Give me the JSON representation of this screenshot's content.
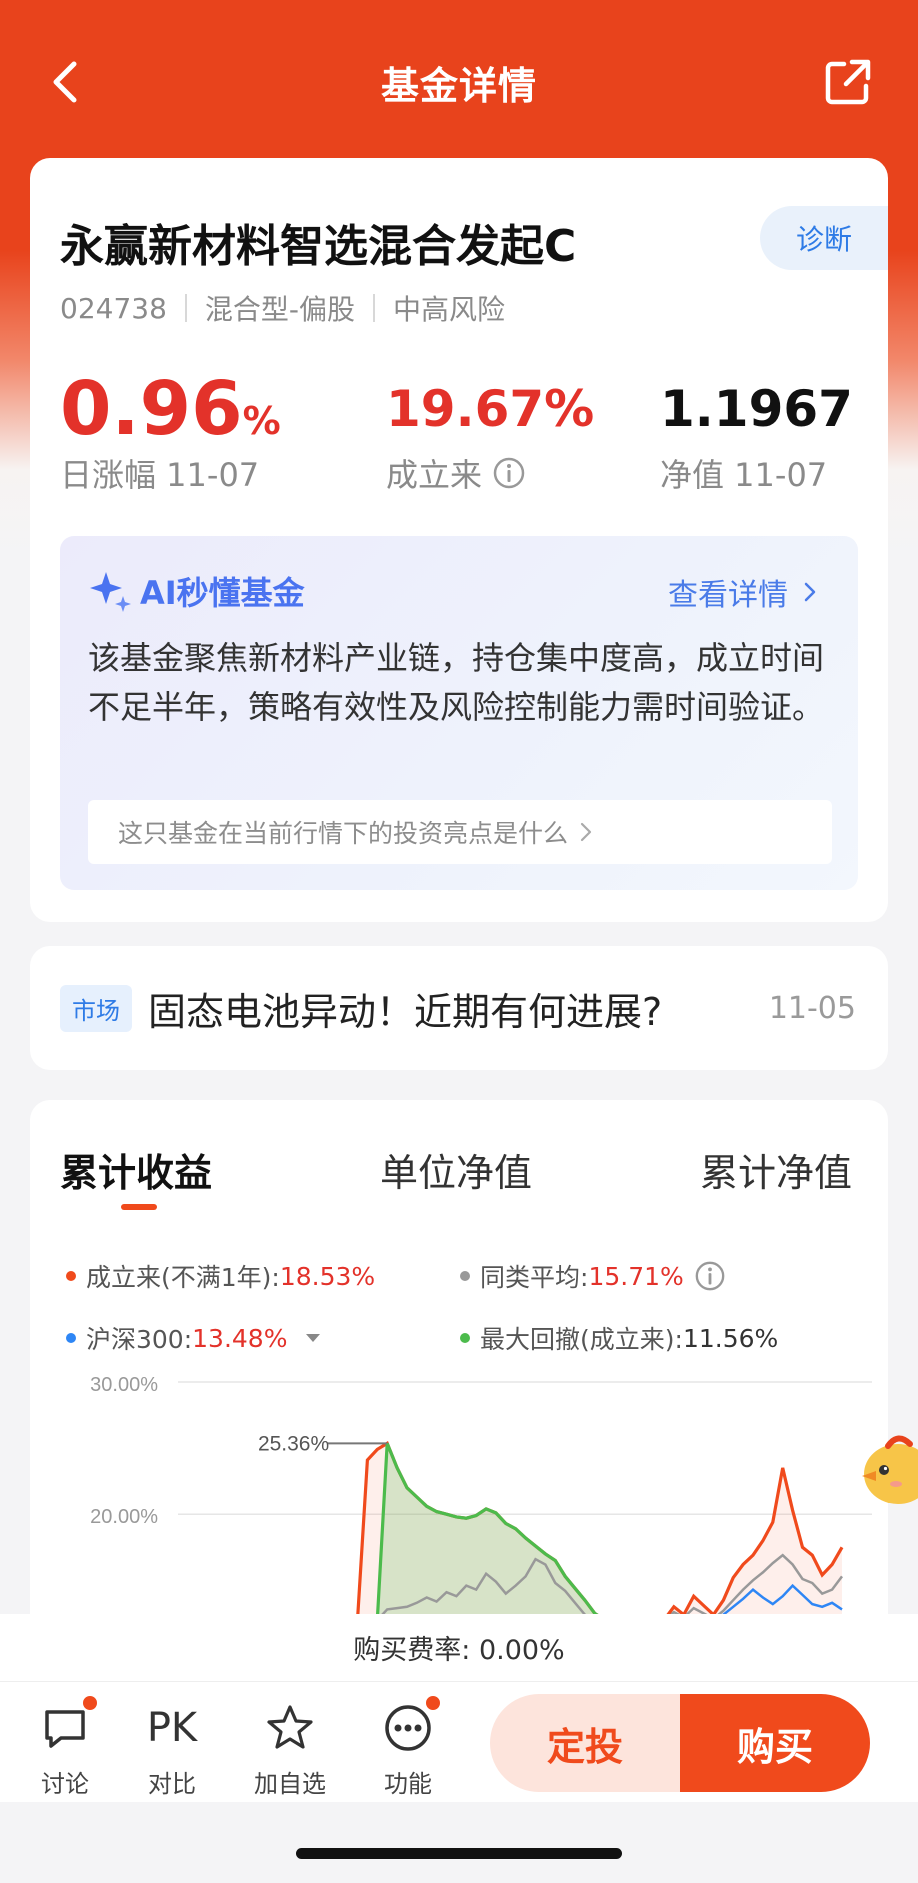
{
  "header": {
    "title": "基金详情"
  },
  "fund": {
    "name": "永赢新材料智选混合发起C",
    "code": "024738",
    "type": "混合型-偏股",
    "risk": "中高风险",
    "diag_label": "诊断",
    "daily_change": "0.96",
    "daily_change_unit": "%",
    "daily_change_label": "日涨幅 11-07",
    "since_inception": "19.67%",
    "since_inception_label": "成立来",
    "nav": "1.1967",
    "nav_label": "净值 11-07"
  },
  "ai": {
    "title": "AI秒懂基金",
    "detail_link": "查看详情",
    "summary": "该基金聚焦新材料产业链，持仓集中度高，成立时间不足半年，策略有效性及风险控制能力需时间验证。",
    "question": "这只基金在当前行情下的投资亮点是什么"
  },
  "news": {
    "tag": "市场",
    "title": "固态电池异动！近期有何进展?",
    "date": "11-05"
  },
  "chart_tabs": [
    {
      "label": "累计收益",
      "active": true
    },
    {
      "label": "单位净值",
      "active": false
    },
    {
      "label": "累计净值",
      "active": false
    }
  ],
  "legend": [
    {
      "name": "成立来(不满1年):",
      "value": "18.53%",
      "color": "#f04a1c"
    },
    {
      "name": "同类平均:",
      "value": "15.71%",
      "color": "#999999"
    },
    {
      "name": "沪深300:",
      "value": "13.48%",
      "color": "#2e86f5"
    },
    {
      "name": "最大回撤(成立来):",
      "value": "11.56%",
      "color": "#4cbb4c"
    }
  ],
  "chart_data": {
    "type": "line",
    "yticks": [
      "30.00%",
      "20.00%"
    ],
    "ylim": [
      12,
      30
    ],
    "peak_label": "25.36%",
    "series": [
      {
        "name": "成立来(不满1年)",
        "color": "#f04a1c",
        "values": [
          12,
          12,
          12,
          12,
          12,
          12,
          12,
          12,
          12,
          12,
          12,
          12,
          12,
          12,
          12,
          12,
          12,
          12,
          12,
          12,
          12,
          12,
          12,
          24.1,
          24.9,
          25.36,
          23.5,
          22.0,
          21.3,
          20.6,
          20.2,
          20.0,
          19.8,
          19.7,
          19.9,
          20.4,
          20.1,
          19.3,
          18.9,
          18.2,
          17.6,
          17.0,
          16.5,
          15.3,
          14.4,
          13.5,
          12.5,
          12,
          12,
          12,
          12,
          12,
          12,
          12,
          13.0,
          12.4,
          13.8,
          13.1,
          12.4,
          13.5,
          15.2,
          16.2,
          16.9,
          18.0,
          19.4,
          23.5,
          20.3,
          17.5,
          16.9,
          15.4,
          16.2,
          17.5
        ]
      },
      {
        "name": "同类平均",
        "color": "#999999",
        "values": [
          12,
          12,
          12,
          12,
          12,
          12,
          12,
          12,
          12,
          12,
          12,
          12,
          12,
          12,
          12,
          12,
          12,
          12,
          12,
          12,
          12,
          12,
          12,
          12,
          12,
          12.8,
          12.9,
          13.0,
          13.3,
          13.7,
          13.4,
          14.1,
          13.8,
          14.6,
          14.3,
          15.5,
          14.9,
          14.0,
          14.6,
          15.3,
          16.6,
          16.2,
          14.8,
          14.2,
          13.3,
          12.4,
          12.0,
          12,
          12,
          12,
          12,
          12,
          12,
          12,
          12.6,
          12.2,
          12.9,
          12.5,
          12.1,
          12.7,
          13.5,
          14.3,
          15.0,
          15.6,
          16.3,
          16.9,
          16.2,
          15.1,
          14.8,
          14.0,
          14.3,
          15.3
        ]
      },
      {
        "name": "沪深300",
        "color": "#2e86f5",
        "values": [
          12,
          12,
          12,
          12,
          12,
          12,
          12,
          12,
          12,
          12,
          12,
          12,
          12,
          12,
          12,
          12,
          12,
          12,
          12,
          12,
          12,
          12,
          12,
          12,
          12,
          12,
          12,
          12,
          12,
          12,
          12,
          12,
          12,
          12,
          12,
          12,
          12,
          12,
          12,
          12,
          12,
          12,
          12,
          12,
          12,
          12,
          12,
          12,
          12,
          12,
          12,
          12,
          12,
          12,
          12,
          12,
          12,
          12,
          12,
          12.4,
          13.0,
          13.6,
          14.3,
          13.7,
          13.2,
          13.8,
          14.6,
          13.9,
          13.2,
          13.0,
          13.3,
          12.8
        ]
      },
      {
        "name": "最大回撤(成立来)",
        "color": "#4cbb4c",
        "values": [
          12,
          12,
          12,
          12,
          12,
          12,
          12,
          12,
          12,
          12,
          12,
          12,
          12,
          12,
          12,
          12,
          12,
          12,
          12,
          12,
          12,
          12,
          12,
          12,
          12,
          25.36,
          23.5,
          22.0,
          21.3,
          20.6,
          20.2,
          20.0,
          19.8,
          19.7,
          19.9,
          20.4,
          20.1,
          19.3,
          18.9,
          18.2,
          17.6,
          17.0,
          16.5,
          15.3,
          14.4,
          13.5,
          12.5,
          12,
          12,
          12,
          12,
          12,
          12,
          12,
          12,
          12,
          12,
          12,
          12,
          12,
          12,
          12,
          12,
          12,
          12,
          12,
          12,
          12,
          12,
          12,
          12,
          12
        ]
      }
    ]
  },
  "fee": {
    "text": "购买费率: 0.00%"
  },
  "bottom": {
    "discuss": "讨论",
    "compare_icon": "PK",
    "compare": "对比",
    "watch": "加自选",
    "more": "功能",
    "dingtou": "定投",
    "buy": "购买"
  },
  "icons": {
    "back": "chevron-left-icon",
    "share": "share-icon",
    "info": "info-icon",
    "sparkle": "sparkle-icon",
    "chevron": "chevron-right-icon",
    "discuss": "chat-bubble-icon",
    "watch": "star-icon",
    "more": "more-dots-icon",
    "mascot": "chick-mascot-icon"
  },
  "colors": {
    "brand": "#e8431c",
    "up": "#e3322a",
    "link": "#2e7be6",
    "ai_link": "#4a7be8"
  }
}
